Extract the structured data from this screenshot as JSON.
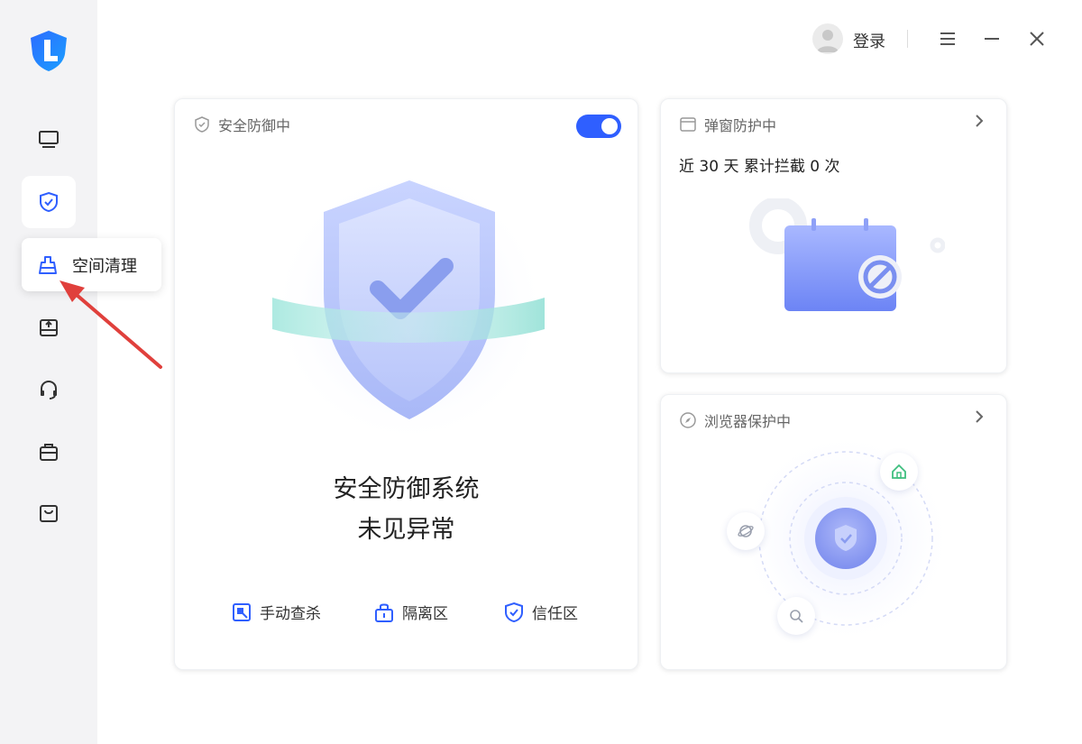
{
  "header": {
    "login_label": "登录"
  },
  "sidebar": {
    "tooltip_label": "空间清理",
    "items": [
      {
        "icon": "monitor-icon"
      },
      {
        "icon": "shield-icon"
      },
      {
        "icon": "broom-icon"
      },
      {
        "icon": "disk-upload-icon"
      },
      {
        "icon": "headset-icon"
      },
      {
        "icon": "toolbox-icon"
      },
      {
        "icon": "shopping-bag-icon"
      }
    ]
  },
  "defense_card": {
    "title": "安全防御中",
    "toggle_on": true,
    "status_line1": "安全防御系统",
    "status_line2": "未见异常",
    "actions": [
      {
        "label": "手动查杀",
        "icon": "scan-icon"
      },
      {
        "label": "隔离区",
        "icon": "lock-icon"
      },
      {
        "label": "信任区",
        "icon": "shield-check-icon"
      }
    ]
  },
  "popup_card": {
    "title": "弹窗防护中",
    "stat": "近 30 天 累计拦截 0 次"
  },
  "browser_card": {
    "title": "浏览器保护中"
  },
  "colors": {
    "accent": "#2f5fff",
    "sidebar_bg": "#f3f3f5",
    "arrow": "#e0403c"
  }
}
